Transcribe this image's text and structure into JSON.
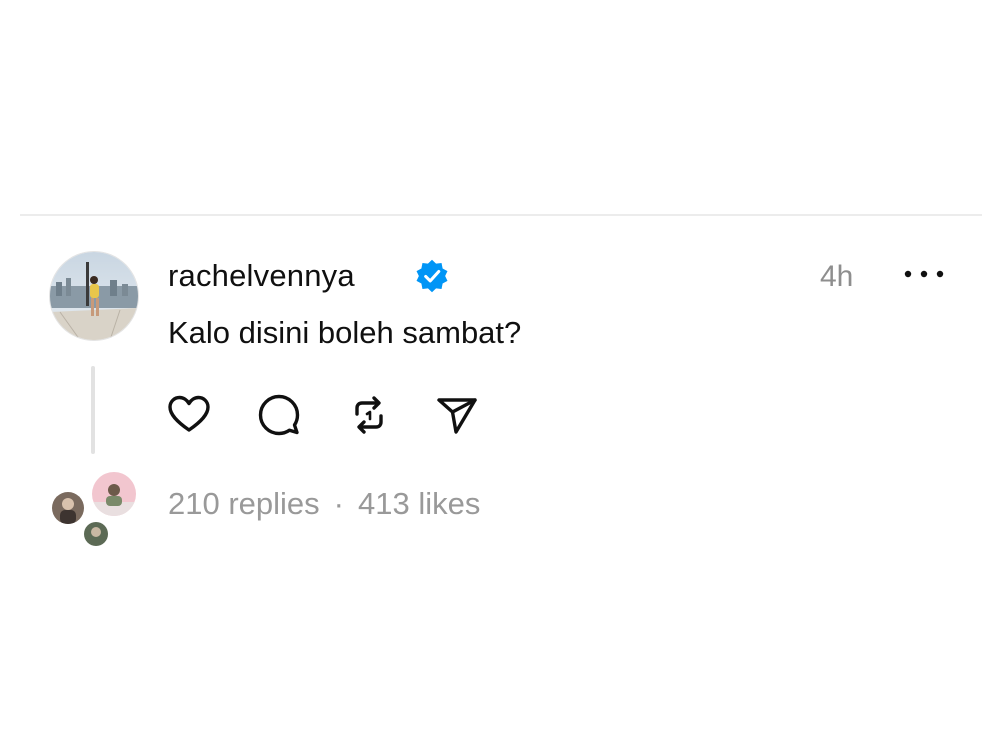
{
  "post": {
    "username": "rachelvennya",
    "verified": true,
    "timestamp": "4h",
    "text": "Kalo disini boleh sambat?",
    "avatar_icon": "user-avatar-photo",
    "more_icon": "more-horizontal-icon"
  },
  "actions": [
    {
      "name": "like",
      "icon": "heart-icon"
    },
    {
      "name": "comment",
      "icon": "comment-bubble-icon"
    },
    {
      "name": "repost",
      "icon": "repost-icon"
    },
    {
      "name": "share",
      "icon": "send-icon"
    }
  ],
  "stats": {
    "replies": "210 replies",
    "separator": "·",
    "likes": "413 likes"
  },
  "colors": {
    "text": "#101010",
    "muted": "#999999",
    "verified": "#0095f6",
    "divider": "#ececec"
  }
}
